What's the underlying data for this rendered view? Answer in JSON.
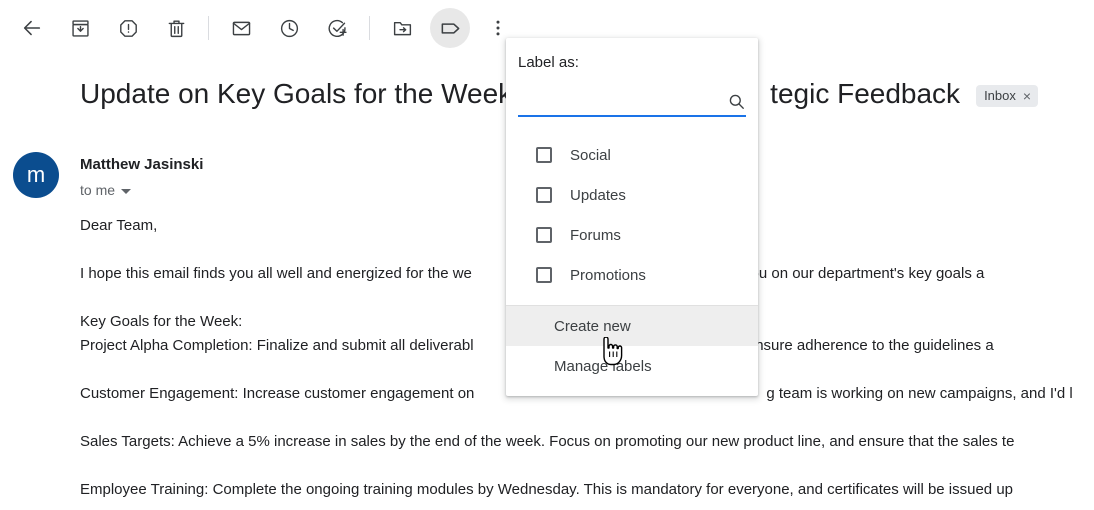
{
  "toolbar": {
    "items": [
      {
        "name": "back-arrow-icon",
        "label": "Back"
      },
      {
        "name": "archive-icon",
        "label": "Archive"
      },
      {
        "name": "report-spam-icon",
        "label": "Report spam"
      },
      {
        "name": "delete-icon",
        "label": "Delete"
      },
      {
        "name": "mark-unread-icon",
        "label": "Mark as unread"
      },
      {
        "name": "snooze-icon",
        "label": "Snooze"
      },
      {
        "name": "add-to-tasks-icon",
        "label": "Add to tasks"
      },
      {
        "name": "move-to-icon",
        "label": "Move to"
      },
      {
        "name": "labels-icon",
        "label": "Labels"
      },
      {
        "name": "more-options-icon",
        "label": "More"
      }
    ]
  },
  "email": {
    "subject_left": "Update on Key Goals for the Week",
    "subject_right": "tegic Feedback",
    "chip_label": "Inbox",
    "chip_close": "×",
    "avatar_initial": "m",
    "sender": "Matthew Jasinski",
    "recipient": "to me",
    "body_lines": [
      "Dear Team,",
      "",
      "I hope this email finds you all well and energized for the we                         to update you on our department's key goals a",
      "",
      "Key Goals for the Week:",
      "Project Alpha Completion: Finalize and submit all deliverabl                         y. Please ensure adherence to the guidelines a",
      "",
      "Customer Engagement: Increase customer engagement on                                   g team is working on new campaigns, and I'd l",
      "",
      "Sales Targets: Achieve a 5% increase in sales by the end of the week. Focus on promoting our new product line, and ensure that the sales te",
      "",
      "Employee Training: Complete the ongoing training modules by Wednesday. This is mandatory for everyone, and certificates will be issued up"
    ]
  },
  "label_menu": {
    "title": "Label as:",
    "search_value": "",
    "search_placeholder": "",
    "labels": [
      {
        "label": "Social",
        "checked": false
      },
      {
        "label": "Updates",
        "checked": false
      },
      {
        "label": "Forums",
        "checked": false
      },
      {
        "label": "Promotions",
        "checked": false
      }
    ],
    "create_new": "Create new",
    "manage_labels": "Manage labels",
    "hovered_action": "Create new"
  },
  "colors": {
    "accent_blue": "#1a73e8",
    "avatar_blue": "#0b4d8f",
    "chip_bg": "#e8eaed",
    "text_primary": "#202124",
    "text_secondary": "#5f6368",
    "hover_bg": "#eeeeee"
  }
}
